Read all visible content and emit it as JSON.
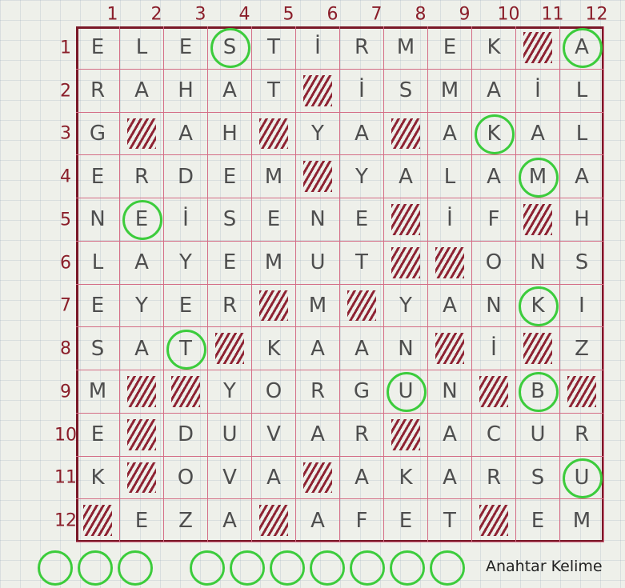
{
  "col_numbers": [
    "1",
    "2",
    "3",
    "4",
    "5",
    "6",
    "7",
    "8",
    "9",
    "10",
    "11",
    "12"
  ],
  "row_numbers": [
    "1",
    "2",
    "3",
    "4",
    "5",
    "6",
    "7",
    "8",
    "9",
    "10",
    "11",
    "12"
  ],
  "grid": [
    [
      "E",
      "L",
      "E",
      "S",
      "T",
      "İ",
      "R",
      "M",
      "E",
      "K",
      "#",
      "A"
    ],
    [
      "R",
      "A",
      "H",
      "A",
      "T",
      "#",
      "İ",
      "S",
      "M",
      "A",
      "İ",
      "L"
    ],
    [
      "G",
      "#",
      "A",
      "H",
      "#",
      "Y",
      "A",
      "#",
      "A",
      "K",
      "A",
      "L"
    ],
    [
      "E",
      "R",
      "D",
      "E",
      "M",
      "#",
      "Y",
      "A",
      "L",
      "A",
      "M",
      "A"
    ],
    [
      "N",
      "E",
      "İ",
      "S",
      "E",
      "N",
      "E",
      "#",
      "İ",
      "F",
      "#",
      "H"
    ],
    [
      "L",
      "A",
      "Y",
      "E",
      "M",
      "U",
      "T",
      "#",
      "#",
      "O",
      "N",
      "S"
    ],
    [
      "E",
      "Y",
      "E",
      "R",
      "#",
      "M",
      "#",
      "Y",
      "A",
      "N",
      "K",
      "I"
    ],
    [
      "S",
      "A",
      "T",
      "#",
      "K",
      "A",
      "A",
      "N",
      "#",
      "İ",
      "#",
      "Z"
    ],
    [
      "M",
      "#",
      "#",
      "Y",
      "O",
      "R",
      "G",
      "U",
      "N",
      "#",
      "B",
      "#"
    ],
    [
      "E",
      "#",
      "D",
      "U",
      "V",
      "A",
      "R",
      "#",
      "A",
      "C",
      "U",
      "R"
    ],
    [
      "K",
      "#",
      "O",
      "V",
      "A",
      "#",
      "A",
      "K",
      "A",
      "R",
      "S",
      "U"
    ],
    [
      "#",
      "E",
      "Z",
      "A",
      "#",
      "A",
      "F",
      "E",
      "T",
      "#",
      "E",
      "M"
    ]
  ],
  "circled_cells": [
    [
      0,
      3
    ],
    [
      0,
      11
    ],
    [
      2,
      9
    ],
    [
      3,
      10
    ],
    [
      4,
      1
    ],
    [
      6,
      10
    ],
    [
      7,
      2
    ],
    [
      8,
      7
    ],
    [
      8,
      10
    ],
    [
      10,
      11
    ]
  ],
  "answer_slots": 10,
  "caption": "Anahtar Kelime",
  "colors": {
    "grid_line": "#d46d86",
    "border": "#7a1828",
    "hatch": "#8e2333",
    "circle": "#3ccc3c",
    "numbers": "#8a1e2a"
  }
}
